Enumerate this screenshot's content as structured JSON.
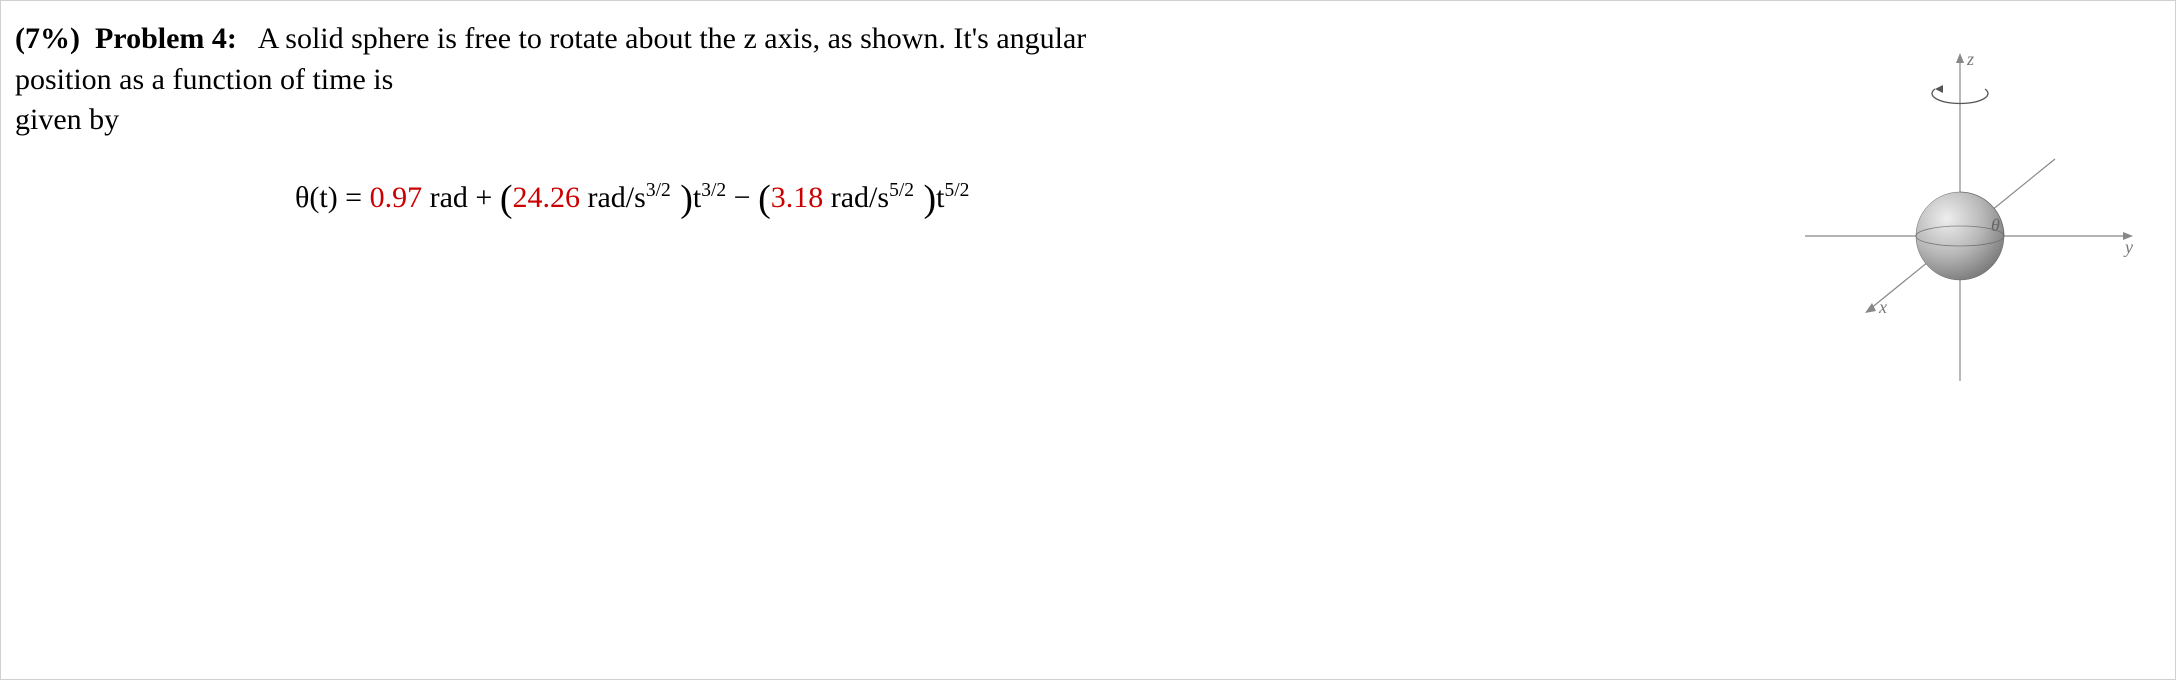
{
  "header": {
    "weight": "(7%)",
    "label": "Problem 4:",
    "text_part1": "A solid sphere is free to rotate about the z axis, as shown. It's angular position as a function of time is",
    "text_part2": "given by"
  },
  "equation": {
    "lhs": "θ(t) = ",
    "c0_val": "0.97",
    "c0_unit": " rad + ",
    "open1": "(",
    "c1_val": "24.26",
    "c1_unit": " rad/s",
    "c1_exp": "3/2",
    "close1": " )",
    "t1": "t",
    "t1_exp": "3/2",
    "minus": " − ",
    "open2": "(",
    "c2_val": "3.18",
    "c2_unit": " rad/s",
    "c2_exp": "5/2",
    "close2": " )",
    "t2": "t",
    "t2_exp": "5/2"
  },
  "figure": {
    "axis_x": "x",
    "axis_y": "y",
    "axis_z": "z",
    "theta": "θ"
  }
}
